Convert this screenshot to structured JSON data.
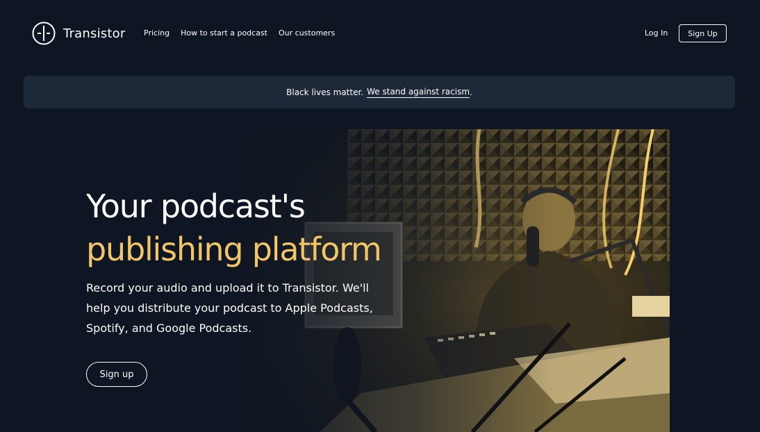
{
  "brand": {
    "name": "Transistor",
    "icon": "transistor-logo-icon"
  },
  "nav": {
    "items": [
      {
        "label": "Pricing"
      },
      {
        "label": "How to start a podcast"
      },
      {
        "label": "Our customers"
      }
    ],
    "login_label": "Log In",
    "signup_label": "Sign Up"
  },
  "banner": {
    "text": "Black lives matter.",
    "link_text": "We stand against racism",
    "trailing": "."
  },
  "hero": {
    "title_line1": "Your podcast's",
    "title_line2": "publishing platform",
    "subtitle": "Record your audio and upload it to Transistor. We'll help you distribute your podcast to Apple Podcasts, Spotify, and Google Podcasts.",
    "cta_label": "Sign up"
  },
  "colors": {
    "background": "#0e1624",
    "banner": "#1d2838",
    "accent": "#f2c566",
    "text": "#ffffff"
  }
}
